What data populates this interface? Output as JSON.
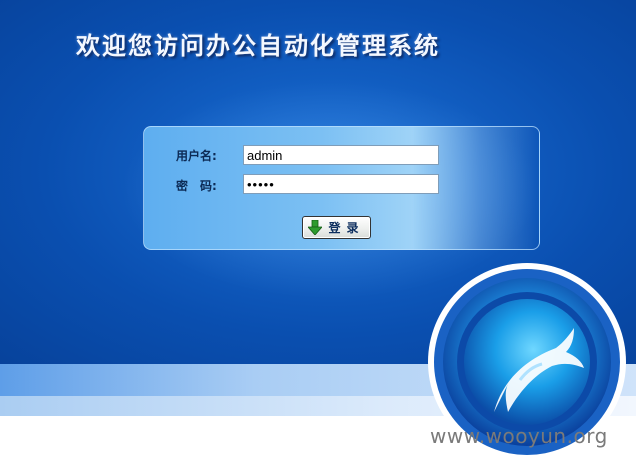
{
  "page": {
    "title": "欢迎您访问办公自动化管理系统"
  },
  "login": {
    "username_label": "用户名:",
    "username_value": "admin",
    "password_label": "密　码:",
    "password_value": "admin",
    "submit_label": "登录"
  },
  "footer": {
    "watermark": "www.wooyun.org"
  },
  "colors": {
    "background_blue": "#0a4fb0",
    "panel_light_blue": "#7cc0f3",
    "button_arrow_green": "#2e9b2e"
  },
  "icons": {
    "button_icon": "down-arrow-icon",
    "logo": "dolphin-logo"
  }
}
